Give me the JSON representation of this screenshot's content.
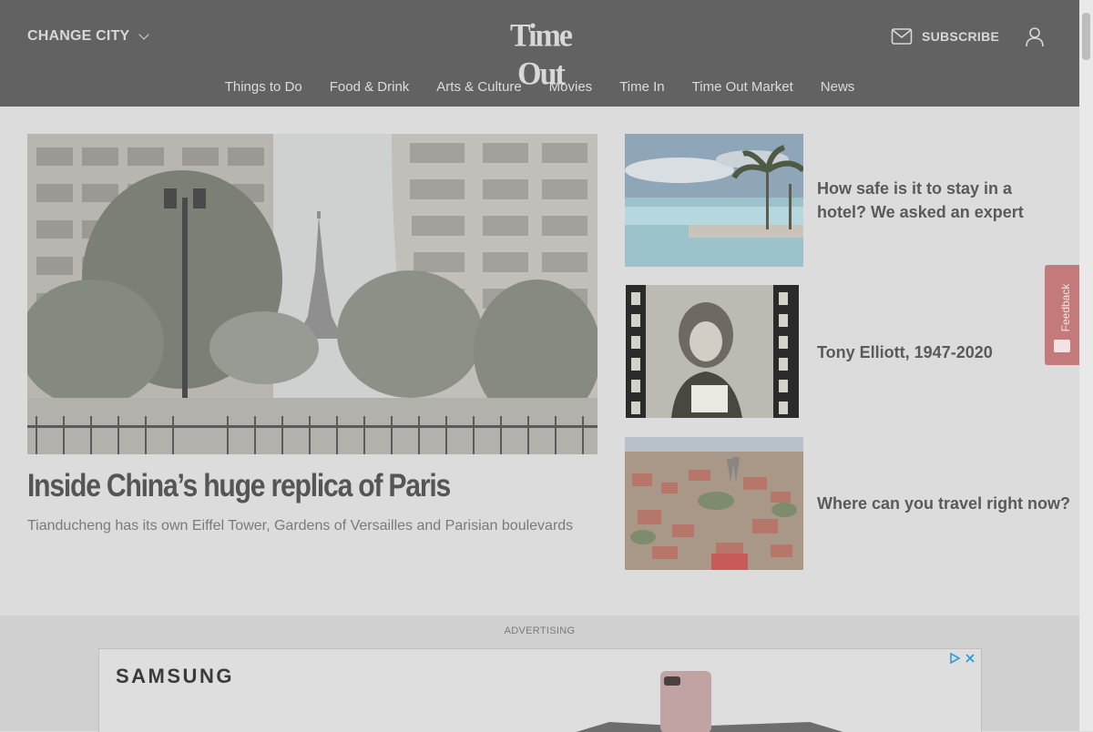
{
  "header": {
    "change_city": "CHANGE CITY",
    "logo": "Time Out",
    "subscribe": "SUBSCRIBE",
    "nav": [
      "Things to Do",
      "Food & Drink",
      "Arts & Culture",
      "Movies",
      "Time In",
      "Time Out Market",
      "News"
    ]
  },
  "hero": {
    "title": "Inside China’s huge replica of Paris",
    "subtitle": "Tianducheng has its own Eiffel Tower, Gardens of Versailles and Parisian boulevards"
  },
  "side_stories": [
    {
      "title": "How safe is it to stay in a hotel? We asked an expert"
    },
    {
      "title": "Tony Elliott, 1947-2020"
    },
    {
      "title": "Where can you travel right now?"
    }
  ],
  "feedback": {
    "label": "Feedback"
  },
  "ad": {
    "label": "ADVERTISING",
    "brand": "SAMSUNG"
  },
  "colors": {
    "header_bg": "#626262",
    "page_bg": "#dcdcdc",
    "feedback_bg": "#c47a7a"
  },
  "icons": {
    "dropdown": "chevron-down-icon",
    "mail": "mail-icon",
    "user": "user-icon",
    "ad_choices": "ad-choices-icon",
    "close": "close-icon"
  }
}
